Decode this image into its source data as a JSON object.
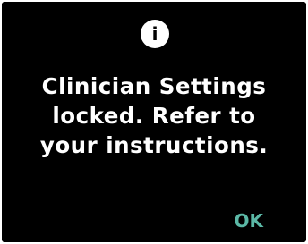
{
  "dialog": {
    "icon": "info-icon",
    "icon_glyph": "i",
    "message_lines": [
      "Clinician Settings",
      "locked. Refer to",
      "your instructions."
    ],
    "ok_label": "OK"
  },
  "colors": {
    "background": "#000000",
    "text": "#ffffff",
    "accent": "#5bb8a6"
  }
}
